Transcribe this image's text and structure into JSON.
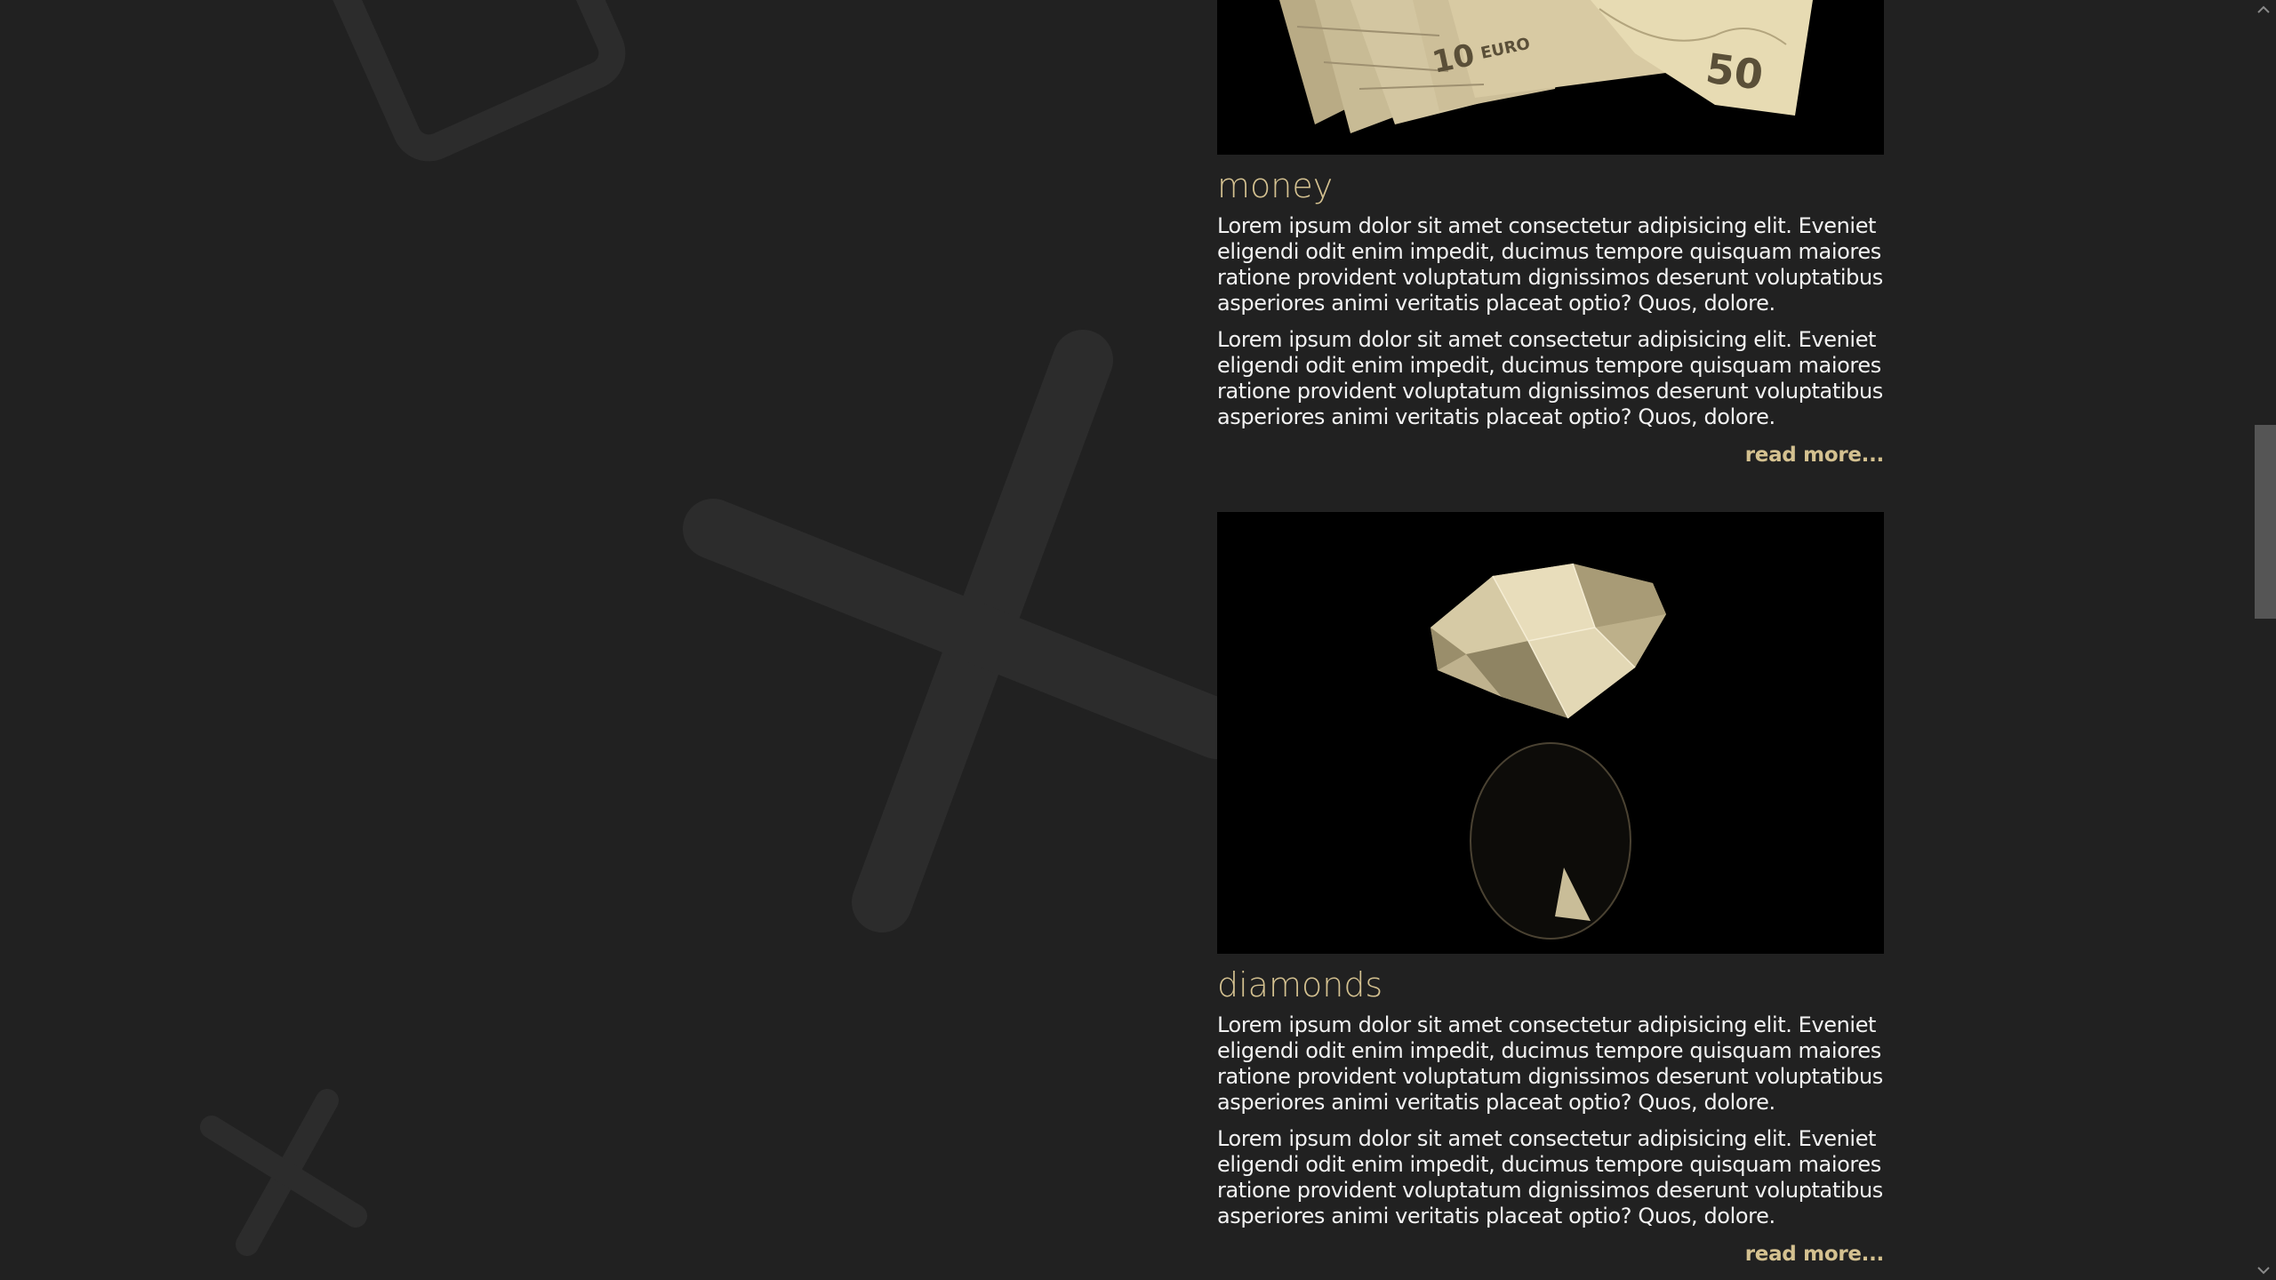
{
  "articles": [
    {
      "title": "money",
      "image_label": "money-photo",
      "banknote_labels": [
        "10",
        "EURO",
        "50"
      ],
      "paragraphs": [
        "Lorem ipsum dolor sit amet consectetur adipisicing elit. Eveniet eligendi odit enim impedit, ducimus tempore quisquam maiores ratione provident voluptatum dignissimos deserunt voluptatibus asperiores animi veritatis placeat optio? Quos, dolore.",
        "Lorem ipsum dolor sit amet consectetur adipisicing elit. Eveniet eligendi odit enim impedit, ducimus tempore quisquam maiores ratione provident voluptatum dignissimos deserunt voluptatibus asperiores animi veritatis placeat optio? Quos, dolore."
      ],
      "read_more": "read more..."
    },
    {
      "title": "diamonds",
      "image_label": "diamond-photo",
      "paragraphs": [
        "Lorem ipsum dolor sit amet consectetur adipisicing elit. Eveniet eligendi odit enim impedit, ducimus tempore quisquam maiores ratione provident voluptatum dignissimos deserunt voluptatibus asperiores animi veritatis placeat optio? Quos, dolore.",
        "Lorem ipsum dolor sit amet consectetur adipisicing elit. Eveniet eligendi odit enim impedit, ducimus tempore quisquam maiores ratione provident voluptatum dignissimos deserunt voluptatibus asperiores animi veritatis placeat optio? Quos, dolore."
      ],
      "read_more": "read more..."
    }
  ],
  "colors": {
    "background": "#212121",
    "accent": "#d4c190",
    "text": "#f2f2f2",
    "decor": "#2c2c2c"
  },
  "scrollbar": {
    "up_icon": "chevron-up-icon",
    "down_icon": "chevron-down-icon"
  }
}
